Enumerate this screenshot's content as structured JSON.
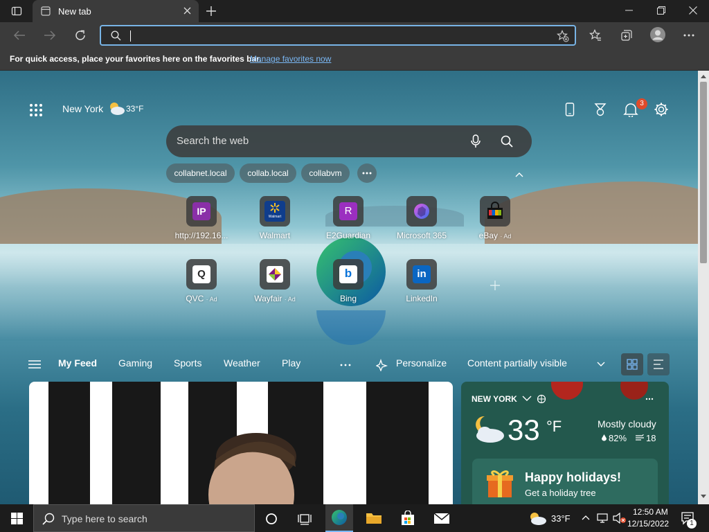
{
  "browser": {
    "tab_title": "New tab",
    "favorites_message": "For quick access, place your favorites here on the favorites bar.",
    "manage_favorites_link": "Manage favorites now"
  },
  "newtab": {
    "location": "New York",
    "temperature": "33°F",
    "notification_count": "3",
    "search_placeholder": "Search the web",
    "recent_searches": [
      "collabnet.local",
      "collab.local",
      "collabvm"
    ],
    "quick_links": [
      {
        "label": "http://192.16...",
        "icon_text": "IP",
        "icon_bg": "#8a2fa8"
      },
      {
        "label": "Walmart",
        "icon_text": "Walmart",
        "icon_bg": "#0f3d8c"
      },
      {
        "label": "E2Guardian",
        "icon_text": "R",
        "icon_bg": "#9b2fc0"
      },
      {
        "label": "Microsoft 365",
        "icon_text": "",
        "icon_bg": "#4a3aa8"
      },
      {
        "label": "eBay",
        "ad": "· Ad",
        "icon_text": "",
        "icon_bg": "#ffffff"
      },
      {
        "label": "QVC",
        "ad": "· Ad",
        "icon_text": "Q",
        "icon_bg": "#ffffff"
      },
      {
        "label": "Wayfair",
        "ad": "· Ad",
        "icon_text": "",
        "icon_bg": "#ffffff"
      },
      {
        "label": "Bing",
        "icon_text": "b",
        "icon_bg": "#ffffff"
      },
      {
        "label": "LinkedIn",
        "icon_text": "in",
        "icon_bg": "#0a66c2"
      }
    ]
  },
  "feed": {
    "tabs": [
      "My Feed",
      "Gaming",
      "Sports",
      "Weather",
      "Play"
    ],
    "personalize_label": "Personalize",
    "content_visibility": "Content partially visible"
  },
  "weather_card": {
    "city": "NEW YORK",
    "temperature": "33",
    "unit": "°F",
    "condition": "Mostly cloudy",
    "humidity": "82%",
    "wind": "18",
    "promo_title": "Happy holidays!",
    "promo_subtitle": "Get a holiday tree"
  },
  "taskbar": {
    "search_placeholder": "Type here to search",
    "weather_temp": "33°F",
    "time": "12:50 AM",
    "date": "12/15/2022",
    "notification_count": "1"
  },
  "colors": {
    "accent": "#78b4e6",
    "link": "#7ab8f5",
    "notification_badge": "#e04a2a"
  }
}
